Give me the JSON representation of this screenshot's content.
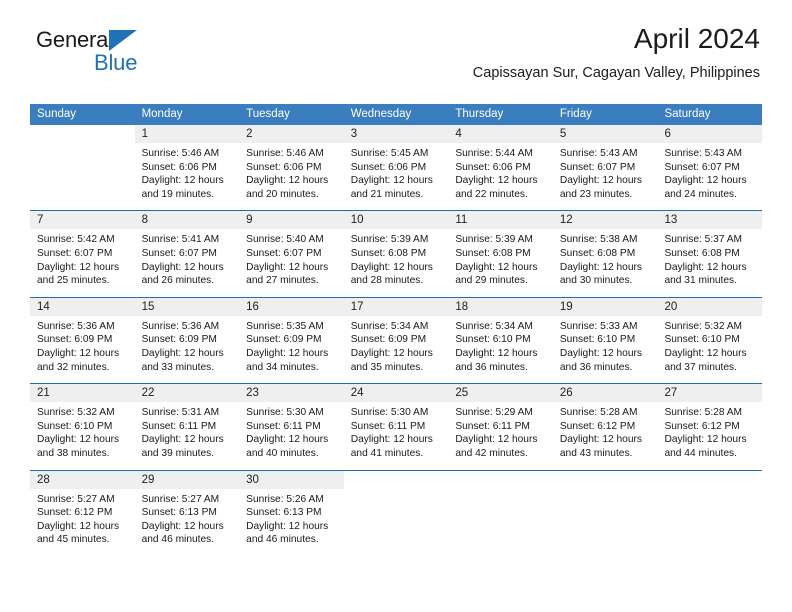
{
  "brand": {
    "name_top": "General",
    "name_bottom": "Blue",
    "accent_color": "#1f72b8",
    "triangle_icon": "triangle-icon"
  },
  "header": {
    "month_title": "April 2024",
    "location": "Capissayan Sur, Cagayan Valley, Philippines"
  },
  "calendar": {
    "header_bg": "#3a7ebf",
    "daynum_bg": "#efefef",
    "separator_color": "#1f6eb2",
    "weekdays": [
      "Sunday",
      "Monday",
      "Tuesday",
      "Wednesday",
      "Thursday",
      "Friday",
      "Saturday"
    ],
    "weeks": [
      [
        {
          "day": "",
          "lines": []
        },
        {
          "day": "1",
          "lines": [
            "Sunrise: 5:46 AM",
            "Sunset: 6:06 PM",
            "Daylight: 12 hours",
            "and 19 minutes."
          ]
        },
        {
          "day": "2",
          "lines": [
            "Sunrise: 5:46 AM",
            "Sunset: 6:06 PM",
            "Daylight: 12 hours",
            "and 20 minutes."
          ]
        },
        {
          "day": "3",
          "lines": [
            "Sunrise: 5:45 AM",
            "Sunset: 6:06 PM",
            "Daylight: 12 hours",
            "and 21 minutes."
          ]
        },
        {
          "day": "4",
          "lines": [
            "Sunrise: 5:44 AM",
            "Sunset: 6:06 PM",
            "Daylight: 12 hours",
            "and 22 minutes."
          ]
        },
        {
          "day": "5",
          "lines": [
            "Sunrise: 5:43 AM",
            "Sunset: 6:07 PM",
            "Daylight: 12 hours",
            "and 23 minutes."
          ]
        },
        {
          "day": "6",
          "lines": [
            "Sunrise: 5:43 AM",
            "Sunset: 6:07 PM",
            "Daylight: 12 hours",
            "and 24 minutes."
          ]
        }
      ],
      [
        {
          "day": "7",
          "lines": [
            "Sunrise: 5:42 AM",
            "Sunset: 6:07 PM",
            "Daylight: 12 hours",
            "and 25 minutes."
          ]
        },
        {
          "day": "8",
          "lines": [
            "Sunrise: 5:41 AM",
            "Sunset: 6:07 PM",
            "Daylight: 12 hours",
            "and 26 minutes."
          ]
        },
        {
          "day": "9",
          "lines": [
            "Sunrise: 5:40 AM",
            "Sunset: 6:07 PM",
            "Daylight: 12 hours",
            "and 27 minutes."
          ]
        },
        {
          "day": "10",
          "lines": [
            "Sunrise: 5:39 AM",
            "Sunset: 6:08 PM",
            "Daylight: 12 hours",
            "and 28 minutes."
          ]
        },
        {
          "day": "11",
          "lines": [
            "Sunrise: 5:39 AM",
            "Sunset: 6:08 PM",
            "Daylight: 12 hours",
            "and 29 minutes."
          ]
        },
        {
          "day": "12",
          "lines": [
            "Sunrise: 5:38 AM",
            "Sunset: 6:08 PM",
            "Daylight: 12 hours",
            "and 30 minutes."
          ]
        },
        {
          "day": "13",
          "lines": [
            "Sunrise: 5:37 AM",
            "Sunset: 6:08 PM",
            "Daylight: 12 hours",
            "and 31 minutes."
          ]
        }
      ],
      [
        {
          "day": "14",
          "lines": [
            "Sunrise: 5:36 AM",
            "Sunset: 6:09 PM",
            "Daylight: 12 hours",
            "and 32 minutes."
          ]
        },
        {
          "day": "15",
          "lines": [
            "Sunrise: 5:36 AM",
            "Sunset: 6:09 PM",
            "Daylight: 12 hours",
            "and 33 minutes."
          ]
        },
        {
          "day": "16",
          "lines": [
            "Sunrise: 5:35 AM",
            "Sunset: 6:09 PM",
            "Daylight: 12 hours",
            "and 34 minutes."
          ]
        },
        {
          "day": "17",
          "lines": [
            "Sunrise: 5:34 AM",
            "Sunset: 6:09 PM",
            "Daylight: 12 hours",
            "and 35 minutes."
          ]
        },
        {
          "day": "18",
          "lines": [
            "Sunrise: 5:34 AM",
            "Sunset: 6:10 PM",
            "Daylight: 12 hours",
            "and 36 minutes."
          ]
        },
        {
          "day": "19",
          "lines": [
            "Sunrise: 5:33 AM",
            "Sunset: 6:10 PM",
            "Daylight: 12 hours",
            "and 36 minutes."
          ]
        },
        {
          "day": "20",
          "lines": [
            "Sunrise: 5:32 AM",
            "Sunset: 6:10 PM",
            "Daylight: 12 hours",
            "and 37 minutes."
          ]
        }
      ],
      [
        {
          "day": "21",
          "lines": [
            "Sunrise: 5:32 AM",
            "Sunset: 6:10 PM",
            "Daylight: 12 hours",
            "and 38 minutes."
          ]
        },
        {
          "day": "22",
          "lines": [
            "Sunrise: 5:31 AM",
            "Sunset: 6:11 PM",
            "Daylight: 12 hours",
            "and 39 minutes."
          ]
        },
        {
          "day": "23",
          "lines": [
            "Sunrise: 5:30 AM",
            "Sunset: 6:11 PM",
            "Daylight: 12 hours",
            "and 40 minutes."
          ]
        },
        {
          "day": "24",
          "lines": [
            "Sunrise: 5:30 AM",
            "Sunset: 6:11 PM",
            "Daylight: 12 hours",
            "and 41 minutes."
          ]
        },
        {
          "day": "25",
          "lines": [
            "Sunrise: 5:29 AM",
            "Sunset: 6:11 PM",
            "Daylight: 12 hours",
            "and 42 minutes."
          ]
        },
        {
          "day": "26",
          "lines": [
            "Sunrise: 5:28 AM",
            "Sunset: 6:12 PM",
            "Daylight: 12 hours",
            "and 43 minutes."
          ]
        },
        {
          "day": "27",
          "lines": [
            "Sunrise: 5:28 AM",
            "Sunset: 6:12 PM",
            "Daylight: 12 hours",
            "and 44 minutes."
          ]
        }
      ],
      [
        {
          "day": "28",
          "lines": [
            "Sunrise: 5:27 AM",
            "Sunset: 6:12 PM",
            "Daylight: 12 hours",
            "and 45 minutes."
          ]
        },
        {
          "day": "29",
          "lines": [
            "Sunrise: 5:27 AM",
            "Sunset: 6:13 PM",
            "Daylight: 12 hours",
            "and 46 minutes."
          ]
        },
        {
          "day": "30",
          "lines": [
            "Sunrise: 5:26 AM",
            "Sunset: 6:13 PM",
            "Daylight: 12 hours",
            "and 46 minutes."
          ]
        },
        {
          "day": "",
          "lines": []
        },
        {
          "day": "",
          "lines": []
        },
        {
          "day": "",
          "lines": []
        },
        {
          "day": "",
          "lines": []
        }
      ]
    ]
  }
}
